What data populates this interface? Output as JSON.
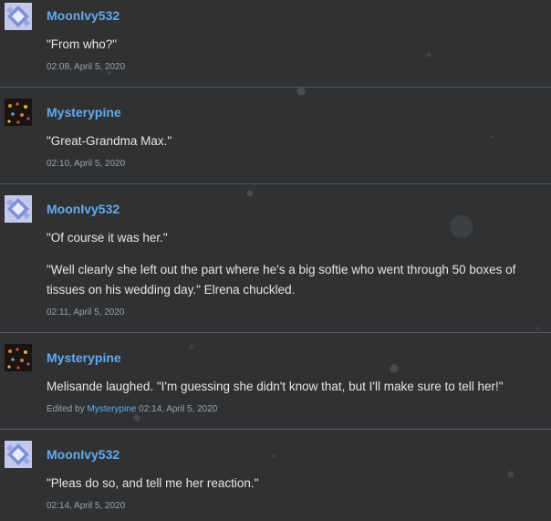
{
  "posts": [
    {
      "author": "MoonIvy532",
      "avatar_icon": "moonivy-avatar-icon",
      "messages": [
        "\"From who?\""
      ],
      "timestamp": "02:08, April 5, 2020"
    },
    {
      "author": "Mysterypine",
      "avatar_icon": "mysterypine-avatar-icon",
      "messages": [
        "\"Great-Grandma Max.\""
      ],
      "timestamp": "02:10, April 5, 2020"
    },
    {
      "author": "MoonIvy532",
      "avatar_icon": "moonivy-avatar-icon",
      "messages": [
        "\"Of course it was her.\"",
        "\"Well clearly she left out the part where he's a big softie who went through 50 boxes of tissues on his wedding day.\" Elrena chuckled."
      ],
      "timestamp": "02:11, April 5, 2020"
    },
    {
      "author": "Mysterypine",
      "avatar_icon": "mysterypine-avatar-icon",
      "messages": [
        "Melisande laughed. \"I'm guessing she didn't know that, but I'll make sure to tell her!\""
      ],
      "edited_prefix": "Edited by",
      "edited_by": "Mysterypine",
      "timestamp": "02:14, April 5, 2020"
    },
    {
      "author": "MoonIvy532",
      "avatar_icon": "moonivy-avatar-icon",
      "messages": [
        "\"Pleas do so, and tell me her reaction.\""
      ],
      "timestamp": "02:14, April 5, 2020"
    }
  ],
  "colors": {
    "background": "#2f3133",
    "author_link": "#62aaf1",
    "message_text": "#e6e6e6",
    "meta_text": "#9ea2a6",
    "divider": "#55585b"
  }
}
